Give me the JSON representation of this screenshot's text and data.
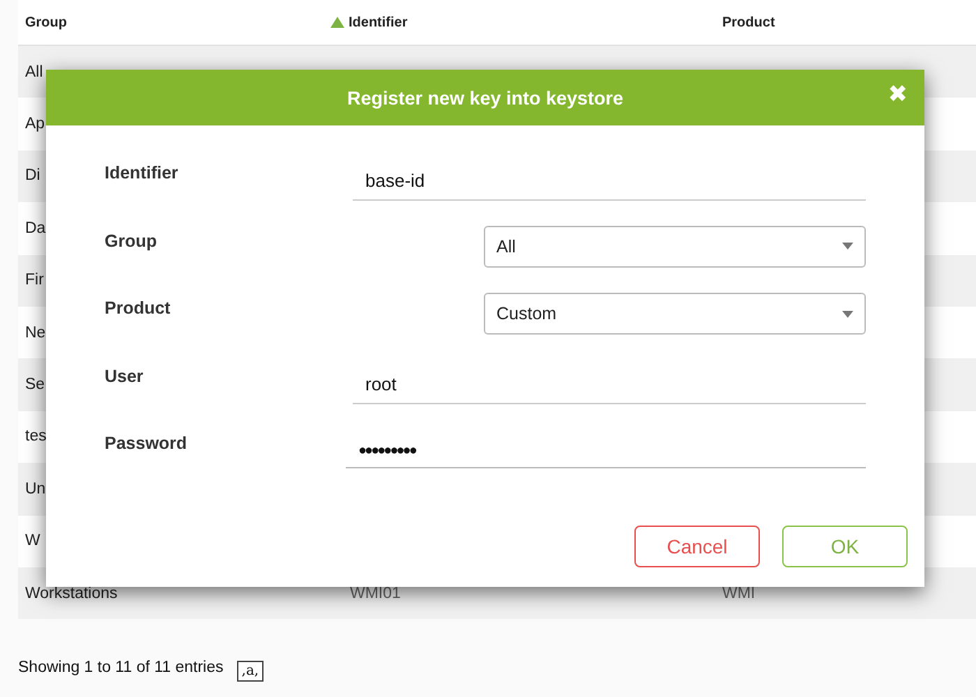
{
  "table": {
    "columns": [
      {
        "label": "Group",
        "sorted": false
      },
      {
        "label": "Identifier",
        "sorted": true
      },
      {
        "label": "Product",
        "sorted": false
      }
    ],
    "rows": [
      {
        "cells": [
          "All"
        ]
      },
      {
        "cells": [
          "Ap"
        ]
      },
      {
        "cells": [
          "Di"
        ]
      },
      {
        "cells": [
          "Da"
        ]
      },
      {
        "cells": [
          "Fir"
        ]
      },
      {
        "cells": [
          "Ne"
        ]
      },
      {
        "cells": [
          "Se"
        ]
      },
      {
        "cells": [
          "tes"
        ]
      },
      {
        "cells": [
          "Un"
        ]
      },
      {
        "cells": [
          "W"
        ]
      },
      {
        "cells": [
          "Workstations",
          "WMI01",
          "WMI"
        ]
      }
    ]
  },
  "footer": {
    "info": "Showing 1 to 11 of 11 entries",
    "format_button": ",a,"
  },
  "dialog": {
    "title": "Register new key into keystore",
    "close": "✖",
    "fields": [
      {
        "label": "Identifier",
        "kind": "text",
        "value": "base-id"
      },
      {
        "label": "Group",
        "kind": "select",
        "value": "All"
      },
      {
        "label": "Product",
        "kind": "select",
        "value": "Custom"
      },
      {
        "label": "User",
        "kind": "text",
        "value": "root"
      },
      {
        "label": "Password",
        "kind": "password",
        "value": "●●●●●●●●●"
      }
    ],
    "buttons": [
      {
        "label": "Cancel",
        "kind": "cancel"
      },
      {
        "label": "OK",
        "kind": "ok"
      }
    ]
  }
}
